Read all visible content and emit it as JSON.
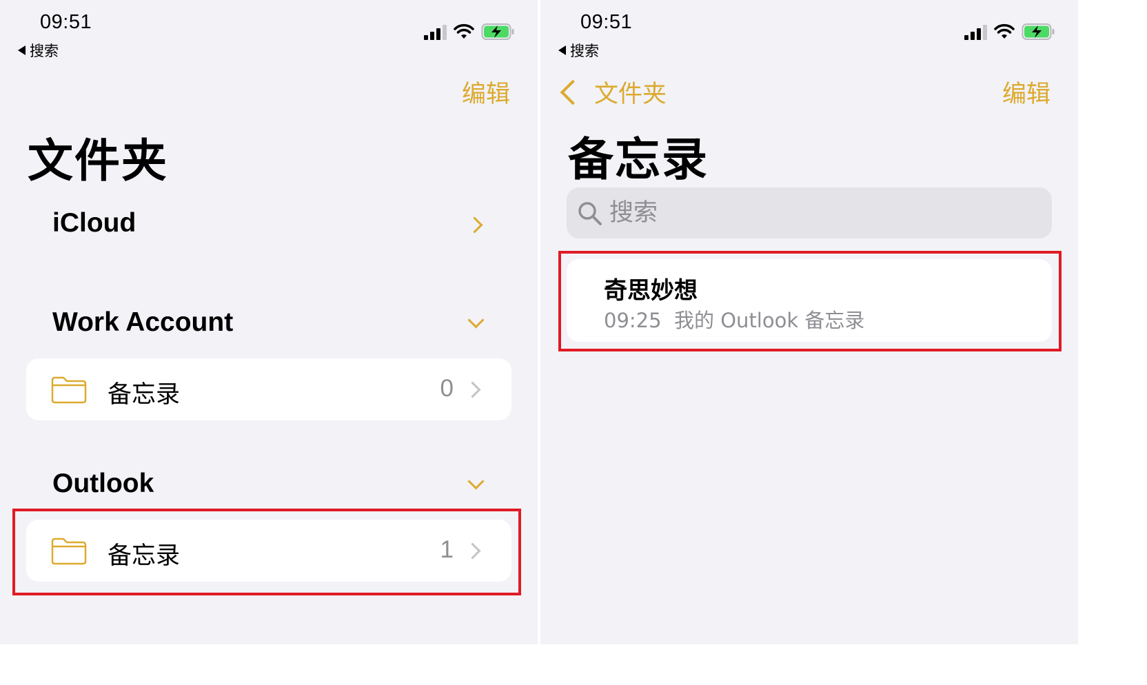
{
  "left": {
    "status": {
      "time": "09:51",
      "back_app": "搜索"
    },
    "edit": "编辑",
    "title": "文件夹",
    "sections": [
      {
        "name": "iCloud"
      },
      {
        "name": "Work Account",
        "folder": {
          "label": "备忘录",
          "count": "0"
        }
      },
      {
        "name": "Outlook",
        "folder": {
          "label": "备忘录",
          "count": "1"
        }
      }
    ]
  },
  "right": {
    "status": {
      "time": "09:51",
      "back_app": "搜索"
    },
    "back": "文件夹",
    "edit": "编辑",
    "title": "备忘录",
    "search": {
      "placeholder": "搜索"
    },
    "note": {
      "title": "奇思妙想",
      "time": "09:25",
      "preview": "我的 Outlook 备忘录"
    }
  },
  "colors": {
    "accent": "#dcaa2f",
    "highlight": "#e01b24",
    "background": "#f2f2f7"
  }
}
